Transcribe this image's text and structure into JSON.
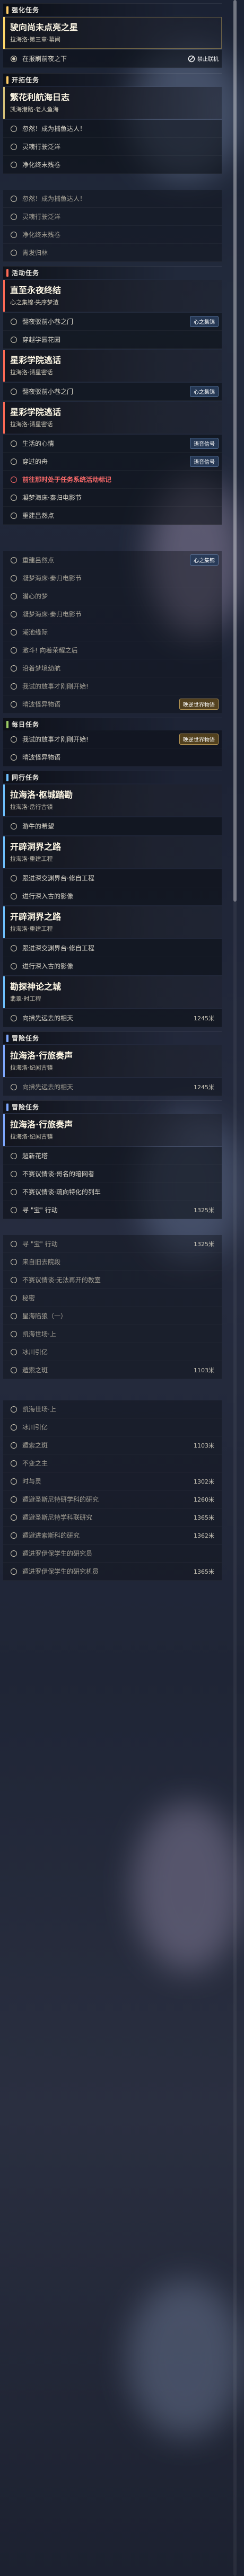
{
  "sections": {
    "challenge": {
      "label": "强化任务",
      "color": "#ffcc66"
    },
    "trailblaze": {
      "label": "开拓任务",
      "color": "#ffcc66"
    },
    "event": {
      "label": "活动任务",
      "color": "#ff6a55"
    },
    "daily": {
      "label": "每日任务",
      "color": "#9ccc65"
    },
    "companion": {
      "label": "同行任务",
      "color": "#6ec1ff"
    },
    "adventure": {
      "label": "冒险任务",
      "color": "#7ea8ff"
    },
    "adventure2": {
      "label": "冒险任务",
      "color": "#7ea8ff"
    }
  },
  "badges": {
    "forbidden": "禁止联机",
    "heart": "心之集锦",
    "voice": "语音信号",
    "story": "晚逆世界物语"
  },
  "cards": {
    "c1": {
      "title": "驶向尚未点亮之星",
      "sub": "拉海洛·第三章·幕间"
    },
    "c2": {
      "title": "繁花利航海日志",
      "sub": "凯海港路·老人鱼海"
    },
    "c3": {
      "title": "直至永夜终结",
      "sub": "心之集锦·失序梦渣"
    },
    "c4": {
      "title": "星彩学院逃话",
      "sub": "拉海洛·请星密话"
    },
    "c5": {
      "title": "星彩学院逃话",
      "sub": "拉海洛·请星密话"
    },
    "c6": {
      "title": "拉海洛·枢城踏勘",
      "sub": "拉海洛·岳行古镇"
    },
    "c7": {
      "title": "开辟洞界之路",
      "sub": "拉海洛·重建工程"
    },
    "c8": {
      "title": "开辟洞界之路",
      "sub": "拉海洛·重建工程"
    },
    "c9": {
      "title": "勘探神论之城",
      "sub": "翡翠·时工程"
    },
    "c10": {
      "title": "拉海洛·行旅奏声",
      "sub": "拉海洛·纪闻古镇"
    },
    "c11": {
      "title": "拉海洛·行旅奏声",
      "sub": "拉海洛·纪闻古镇"
    }
  },
  "steps": {
    "s1": "在报刷前夜之下",
    "s2": "忽然！成为捕鱼达人！",
    "s3": "灵魂行驶泛洋",
    "s4": "净化终末残卷",
    "s5": "忽然！成为捕鱼达人！",
    "s6": "灵魂行驶泛洋",
    "s7": "净化终末残卷",
    "s8": "青发归林",
    "s9": "翻夜驳前小巷之门",
    "s10": "穿越学园花园",
    "s11": "翻夜驳前小巷之门",
    "s12": "生活的心情",
    "s13": "穿过的舟",
    "s14": "前往那时处于任务系统活动标记",
    "s15": "凝梦海床·秦归电影节",
    "s16": "重建吕然点",
    "s17": "重建吕然点",
    "s18": "凝梦海床·秦归电影节",
    "s19": "潜心的梦",
    "s20": "凝梦海床·秦归电影节",
    "s21": "潮池缘际",
    "s22": "激斗! 向着荣耀之后",
    "s23": "沿着梦境幼航",
    "s24": "我试的放事才刚刚开始!",
    "s25": "晴波怪异物语",
    "s26": "我试的放事才刚刚开始!",
    "s27": "晴波怪异物语",
    "s28": "游牛的希望",
    "s29": "跟进深交渊界台·修自工程",
    "s30": "进行深入古的影像",
    "s31": "跟进深交渊界台·修自工程",
    "s32": "进行深入古的影像",
    "s33": "向拂先远去的相天",
    "s34": "向拂先远去的相天",
    "s35": "超新花塔",
    "s36": "不赛议情谈·哥名的暗网者",
    "s37": "不赛议情谈·疏向特化的列车",
    "s38": "寻 \"宝\" 行动",
    "s39": "寻 \"宝\" 行动",
    "s40": "来自旧去院段",
    "s41": "不赛议情谈·无法再开的教室",
    "s42": "秘密",
    "s43": "星海陷狼（一）",
    "s44": "凯海世场·上",
    "s45": "冰川引亿",
    "s46": "遁索之斑",
    "s47": "凯海世场·上",
    "s48": "冰川引亿",
    "s49": "遁索之斑",
    "s50": "不变之主",
    "s51": "时与灵",
    "s52": "遁避圣斯尼特研学科的研究",
    "s53": "遁避圣斯尼特学科联研究",
    "s54": "遁避进索斯科的研究",
    "s55": "遁进罗伊保学生的研究员",
    "s56": "遁进罗伊保学生的研究机员"
  },
  "distances": {
    "d1": "1245米",
    "d2": "1245米",
    "d3": "1325米",
    "d4": "1325米",
    "d5": "1103米",
    "d6": "1103米",
    "d7": "1302米",
    "d8": "1260米",
    "d9": "1365米",
    "d10": "1362米",
    "d11": "1365米"
  },
  "scroll": {
    "thumb_fraction": 0.35
  }
}
